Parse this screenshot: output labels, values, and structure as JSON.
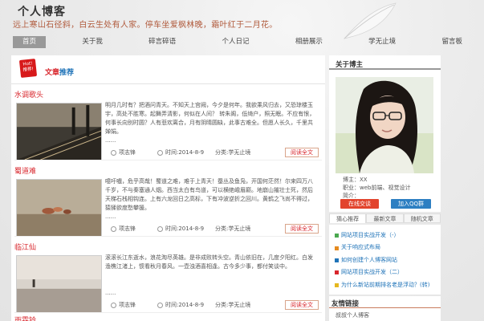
{
  "header": {
    "title": "个人博客",
    "subtitle": "远上寒山石径斜，白云生处有人家。停车坐爱枫林晚，霜叶红于二月花。"
  },
  "nav": [
    "首页",
    "关于我",
    "碎言碎语",
    "个人日记",
    "相册展示",
    "学无止境",
    "留言板"
  ],
  "recommend": {
    "hot_icon_top": "Hot!",
    "hot_icon_bottom": "推荐!",
    "title_part1": "文章",
    "title_part2": "推荐"
  },
  "articles": [
    {
      "title": "水调歌头",
      "body": "明月几时有？把酒问青天。不知天上宫阙，今夕是何年。我欲乘风归去，又恐琼楼玉宇，高处不胜寒。起舞弄清影，何似在人间？ 转朱阁，低绮户，照无眠。不应有恨，何事长向别时圆？人有悲欢离合，月有阴晴圆缺，此事古难全。但愿人长久，千里共婵娟。",
      "dots": "......",
      "author": "项志锋",
      "time": "时间:2014-8-9",
      "category": "分类:学无止境",
      "more": "阅读全文"
    },
    {
      "title": "蜀道难",
      "body": "噫吁嚱，危乎高哉！蜀道之难，难于上青天！蚕丛及鱼凫，开国何茫然！尔来四万八千岁，不与秦塞通人烟。西当太白有鸟道，可以横绝峨眉巅。地崩山摧壮士死，然后天梯石栈相钩连。上有六龙回日之高标，下有冲波逆折之回川。黄鹤之飞尚不得过，猿猱欲度愁攀援。",
      "dots": "......",
      "author": "项志锋",
      "time": "时间:2014-8-9",
      "category": "分类:学无止境",
      "more": "阅读全文"
    },
    {
      "title": "临江仙",
      "body": "滚滚长江东逝水，浪花淘尽英雄。是非成败转头空。青山依旧在，几度夕阳红。白发渔樵江渚上，惯看秋月春风。一壶浊酒喜相逢。古今多少事，都付笑谈中。",
      "dots": "......",
      "author": "项志锋",
      "time": "时间:2014-8-9",
      "category": "分类:学无止境",
      "more": "阅读全文"
    }
  ],
  "next_article_title": "雨霖铃",
  "about": {
    "heading": "关于博主",
    "name": "博主：XX",
    "job": "职业：web前端、视觉设计",
    "intro": "简介：",
    "online_btn": "在线交谈",
    "qq_btn": "加入QQ群"
  },
  "tabs": [
    "猜心推荐",
    "最新文章",
    "随机文章"
  ],
  "tab_list": [
    {
      "text": "网站项目实战开发（-）",
      "color": "#4aa84f"
    },
    {
      "text": "关于响应式布局",
      "color": "#e58a1f"
    },
    {
      "text": "如何创建个人博客网站",
      "color": "#1f73b8"
    },
    {
      "text": "网站项目实战开发（二）",
      "color": "#d8262c"
    },
    {
      "text": "为什么新站前期排名老是浮动？(转)",
      "color": "#e5b81f"
    }
  ],
  "friends": {
    "heading": "友情链接",
    "item": "叔叔个人博客"
  }
}
